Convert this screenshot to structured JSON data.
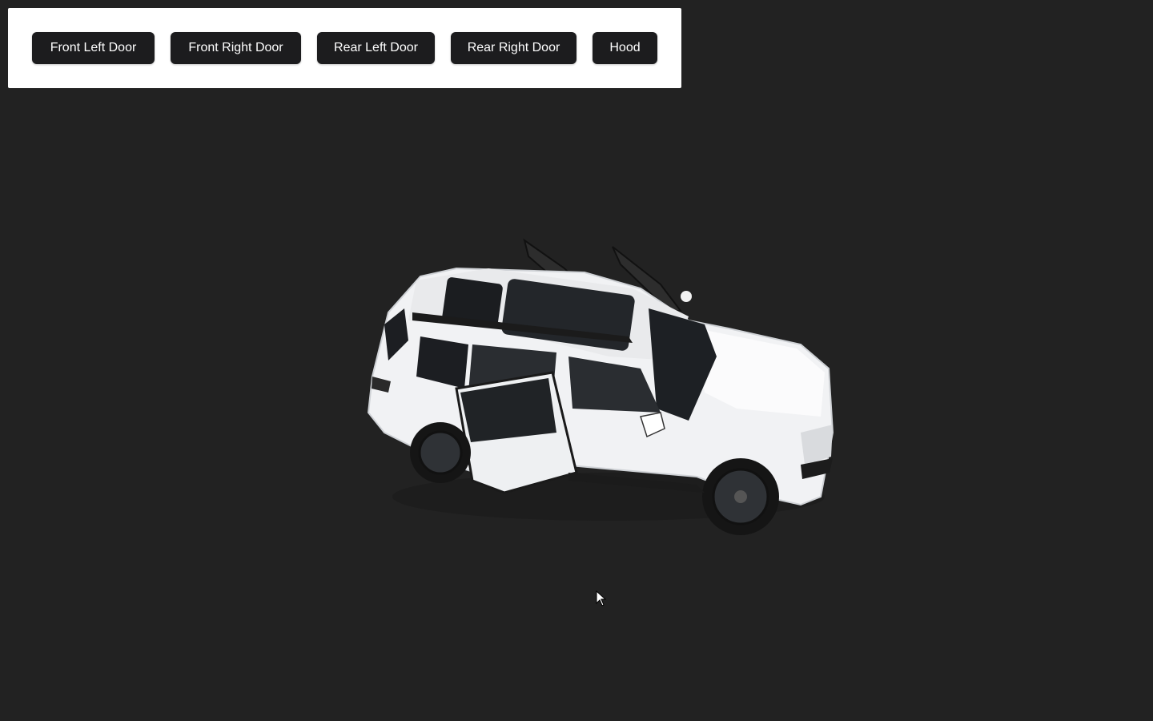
{
  "toolbar": {
    "buttons": [
      {
        "label": "Front Left Door"
      },
      {
        "label": "Front Right Door"
      },
      {
        "label": "Rear Left Door"
      },
      {
        "label": "Rear Right Door"
      },
      {
        "label": "Hood"
      }
    ]
  },
  "scene": {
    "background_color": "#222222",
    "model": "car-model",
    "model_color": "#f4f5f7"
  },
  "cursor": {
    "icon": "pointer-arrow-icon"
  }
}
